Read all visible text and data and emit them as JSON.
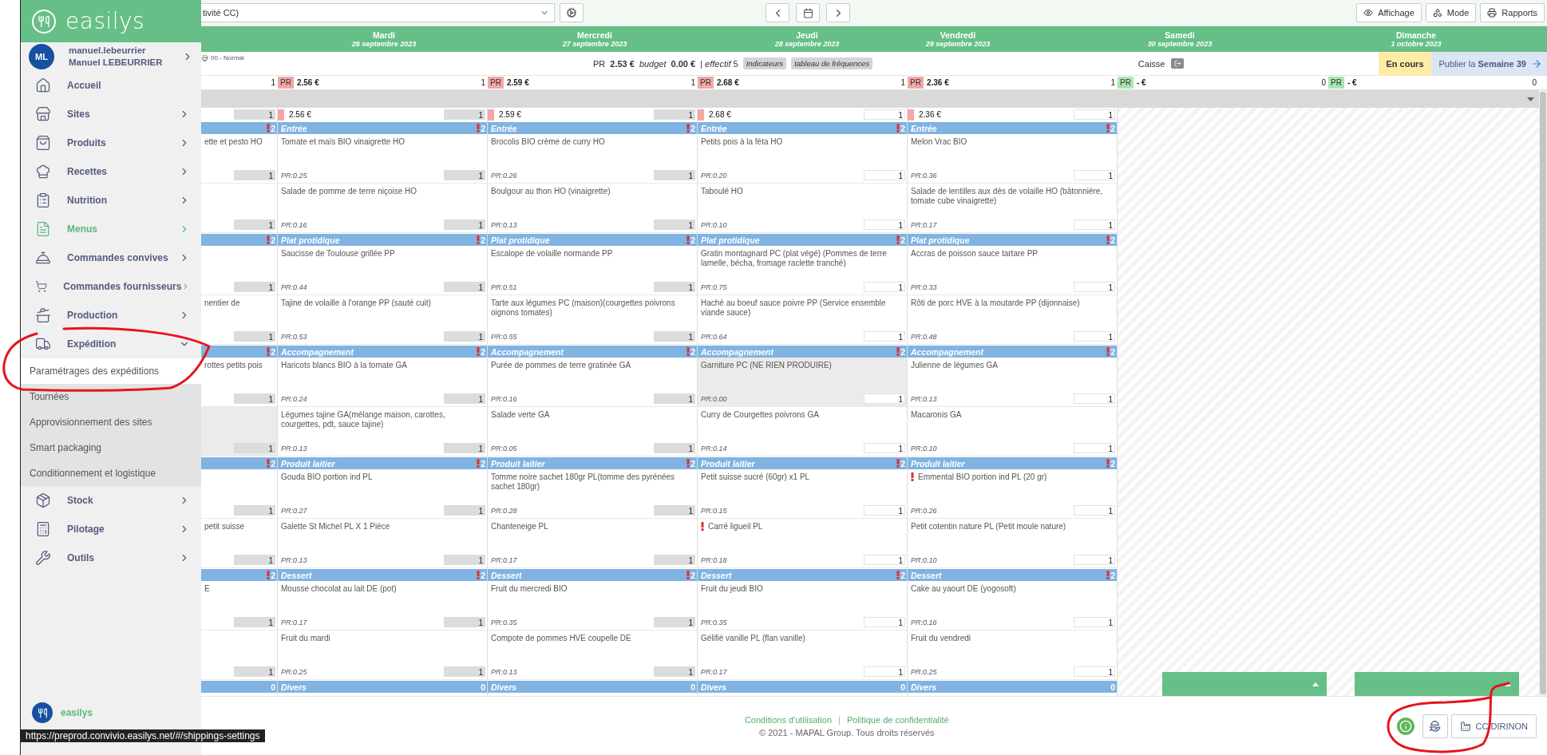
{
  "sidebar": {
    "brand": "easilys",
    "user": {
      "initials": "ML",
      "login": "manuel.lebeurrier",
      "name": "Manuel LEBEURRIER"
    },
    "items": [
      {
        "label": "Accueil",
        "active": false
      },
      {
        "label": "Sites",
        "active": false,
        "expanded": false
      },
      {
        "label": "Produits",
        "active": false,
        "expanded": false
      },
      {
        "label": "Recettes",
        "active": false,
        "expanded": false
      },
      {
        "label": "Nutrition",
        "active": false,
        "expanded": false
      },
      {
        "label": "Menus",
        "active": true,
        "expanded": false
      },
      {
        "label": "Commandes convives",
        "active": false,
        "expanded": false
      },
      {
        "label": "Commandes fournisseurs",
        "active": false,
        "expanded": false
      },
      {
        "label": "Production",
        "active": false,
        "expanded": false
      },
      {
        "label": "Expédition",
        "active": false,
        "expanded": true,
        "children": [
          {
            "label": "Paramétrages des expéditions",
            "selected": true
          },
          {
            "label": "Tournées",
            "selected": false
          },
          {
            "label": "Approvisionnement des sites",
            "selected": false
          },
          {
            "label": "Smart packaging",
            "selected": false
          },
          {
            "label": "Conditionnement et logistique",
            "selected": false
          }
        ]
      },
      {
        "label": "Stock",
        "active": false,
        "expanded": false
      },
      {
        "label": "Pilotage",
        "active": false,
        "expanded": false
      },
      {
        "label": "Outils",
        "active": false,
        "expanded": false
      }
    ],
    "footer_brand": "easilys"
  },
  "status_url": "https://preprod.convivio.easilys.net/#/shippings-settings",
  "toolbar": {
    "site_select": "tivité CC)",
    "buttons": [
      "Affichage",
      "Mode",
      "Rapports"
    ]
  },
  "day_headers": [
    {
      "day": "Mardi",
      "date": "26 septembre 2023"
    },
    {
      "day": "Mercredi",
      "date": "27 septembre 2023"
    },
    {
      "day": "Jeudi",
      "date": "28 septembre 2023"
    },
    {
      "day": "Vendredi",
      "date": "29 septembre 2023"
    },
    {
      "day": "Samedi",
      "date": "30 septembre 2023"
    },
    {
      "day": "Dimanche",
      "date": "1 octobre 2023"
    }
  ],
  "summary": {
    "mode": "00 - Normal",
    "pr_label": "PR",
    "pr_value": "2.53 €",
    "budget_label": "budget",
    "budget_value": "0.00 €",
    "effectif": "| *effectif* 5",
    "tags": [
      "Indicateurs",
      "tableau de fréquences"
    ],
    "caisse": "Caisse",
    "status": "En cours",
    "publish": "Publier la **Semaine 39**"
  },
  "totals": [
    {
      "count": "1"
    },
    {
      "label": "PR",
      "value": "2.56 €",
      "count": "1",
      "color": "#f4a7a7"
    },
    {
      "label": "PR",
      "value": "2.59 €",
      "count": "1",
      "color": "#f4a7a7"
    },
    {
      "label": "PR",
      "value": "2.68 €",
      "count": "1",
      "color": "#f4a7a7"
    },
    {
      "label": "PR",
      "value": "2.36 €",
      "count": "1",
      "color": "#f4a7a7"
    },
    {
      "label": "PR",
      "value": "- €",
      "count": "0",
      "color": "#a9e6b0"
    },
    {
      "label": "PR",
      "value": "- €",
      "count": "0",
      "color": "#a9e6b0"
    }
  ],
  "columns": [
    {
      "editable": false,
      "price": {
        "count": "1"
      },
      "sections": [
        {
          "badge": "2",
          "alert": true,
          "dishes": [
            {
              "name": "ette et pesto HO",
              "count": "1",
              "alert": false,
              "disabled": false
            },
            {
              "count": "1",
              "alert": false,
              "disabled": false
            }
          ]
        },
        {
          "badge": "2",
          "alert": true,
          "dishes": [
            {
              "count": "1",
              "alert": false,
              "disabled": false
            },
            {
              "name": "nentier de",
              "count": "1",
              "alert": false,
              "disabled": false
            }
          ]
        },
        {
          "badge": "2",
          "alert": true,
          "dishes": [
            {
              "name": "rottes petits pois",
              "count": "1",
              "alert": false,
              "disabled": false
            },
            {
              "count": "1",
              "alert": false,
              "disabled": true
            }
          ]
        },
        {
          "badge": "2",
          "alert": true,
          "dishes": [
            {
              "count": "1",
              "alert": false,
              "disabled": false
            },
            {
              "name": "petit suisse",
              "count": "1",
              "alert": false,
              "disabled": false
            }
          ]
        },
        {
          "badge": "2",
          "alert": true,
          "dishes": [
            {
              "name": "E",
              "count": "1",
              "alert": false,
              "disabled": false
            },
            {
              "count": "1",
              "alert": false,
              "disabled": false
            }
          ]
        },
        {
          "badge": "0",
          "alert": false
        }
      ]
    },
    {
      "editable": false,
      "price": {
        "value": "2.56 €",
        "count": "1"
      },
      "sections": [
        {
          "category": "Entrée",
          "badge": "2",
          "alert": true,
          "dishes": [
            {
              "name": "Tomate et maïs BIO vinaigrette HO",
              "pr": "PR:0.25",
              "count": "1",
              "alert": false,
              "disabled": false
            },
            {
              "name": "Salade de pomme de terre niçoise HO",
              "pr": "PR:0.16",
              "count": "1",
              "alert": false,
              "disabled": false
            }
          ]
        },
        {
          "category": "Plat protidique",
          "badge": "2",
          "alert": true,
          "dishes": [
            {
              "name": "Saucisse de Toulouse grillée PP",
              "pr": "PR:0.44",
              "count": "1",
              "alert": false,
              "disabled": false
            },
            {
              "name": "Tajine de volaille à l'orange PP (sauté cuit)",
              "pr": "PR:0.53",
              "count": "1",
              "alert": false,
              "disabled": false
            }
          ]
        },
        {
          "category": "Accompagnement",
          "badge": "2",
          "alert": true,
          "dishes": [
            {
              "name": "Haricots blancs BIO à la tomate GA",
              "pr": "PR:0.24",
              "count": "1",
              "alert": false,
              "disabled": false
            },
            {
              "name": "Légumes tajine GA(mélange maison, carottes, courgettes, pdt, sauce tajine)",
              "pr": "PR:0.13",
              "count": "1",
              "alert": false,
              "disabled": false
            }
          ]
        },
        {
          "category": "Produit laitier",
          "badge": "2",
          "alert": true,
          "dishes": [
            {
              "name": "Gouda BIO portion ind PL",
              "pr": "PR:0.27",
              "count": "1",
              "alert": false,
              "disabled": false
            },
            {
              "name": "Galette St Michel PL X 1 Pièce",
              "pr": "PR:0.13",
              "count": "1",
              "alert": false,
              "disabled": false
            }
          ]
        },
        {
          "category": "Dessert",
          "badge": "2",
          "alert": true,
          "dishes": [
            {
              "name": "Mousse chocolat au lait DE (pot)",
              "pr": "PR:0.17",
              "count": "1",
              "alert": false,
              "disabled": false
            },
            {
              "name": "Fruit du mardi",
              "pr": "PR:0.25",
              "count": "1",
              "alert": false,
              "disabled": false
            }
          ]
        },
        {
          "category": "Divers",
          "badge": "0",
          "alert": false
        }
      ]
    },
    {
      "editable": false,
      "price": {
        "value": "2.59 €",
        "count": "1"
      },
      "sections": [
        {
          "category": "Entrée",
          "badge": "2",
          "alert": true,
          "dishes": [
            {
              "name": "Brocolis BIO crème de curry HO",
              "pr": "PR:0.26",
              "count": "1",
              "alert": false,
              "disabled": false
            },
            {
              "name": "Boulgour au thon HO (vinaigrette)",
              "pr": "PR:0.13",
              "count": "1",
              "alert": false,
              "disabled": false
            }
          ]
        },
        {
          "category": "Plat protidique",
          "badge": "2",
          "alert": true,
          "dishes": [
            {
              "name": "Escalope de volaille normande PP",
              "pr": "PR:0.51",
              "count": "1",
              "alert": false,
              "disabled": false
            },
            {
              "name": "Tarte aux légumes PC (maison)(courgettes poivrons oignons tomates)",
              "pr": "PR:0.55",
              "count": "1",
              "alert": false,
              "disabled": false
            }
          ]
        },
        {
          "category": "Accompagnement",
          "badge": "2",
          "alert": true,
          "dishes": [
            {
              "name": "Purée de pommes de terre gratinée GA",
              "pr": "PR:0.16",
              "count": "1",
              "alert": false,
              "disabled": false
            },
            {
              "name": "Salade verte GA",
              "pr": "PR:0.05",
              "count": "1",
              "alert": false,
              "disabled": false
            }
          ]
        },
        {
          "category": "Produit laitier",
          "badge": "2",
          "alert": true,
          "dishes": [
            {
              "name": "Tomme noire sachet 180gr PL(tomme des pyrénées sachet 180gr)",
              "pr": "PR:0.28",
              "count": "1",
              "alert": false,
              "disabled": false
            },
            {
              "name": "Chanteneige PL",
              "pr": "PR:0.17",
              "count": "1",
              "alert": false,
              "disabled": false
            }
          ]
        },
        {
          "category": "Dessert",
          "badge": "2",
          "alert": true,
          "dishes": [
            {
              "name": "Fruit du mercredi BIO",
              "pr": "PR:0.35",
              "count": "1",
              "alert": false,
              "disabled": false
            },
            {
              "name": "Compote de pommes HVE coupelle DE",
              "pr": "PR:0.13",
              "count": "1",
              "alert": false,
              "disabled": false
            }
          ]
        },
        {
          "category": "Divers",
          "badge": "0",
          "alert": false
        }
      ]
    },
    {
      "editable": true,
      "price": {
        "value": "2.68 €",
        "count": "1"
      },
      "sections": [
        {
          "category": "Entrée",
          "badge": "2",
          "alert": true,
          "dishes": [
            {
              "name": "Petits pois à la féta HO",
              "pr": "PR:0.20",
              "count": "1",
              "alert": false,
              "disabled": false
            },
            {
              "name": "Taboulé HO",
              "pr": "PR:0.10",
              "count": "1",
              "alert": false,
              "disabled": false
            }
          ]
        },
        {
          "category": "Plat protidique",
          "badge": "2",
          "alert": true,
          "dishes": [
            {
              "name": "Gratin montagnard PC (plat végé) (Pommes de terre lamelle, bécha, fromage raclette tranché)",
              "pr": "PR:0.75",
              "count": "1",
              "alert": false,
              "disabled": false
            },
            {
              "name": "Haché au boeuf sauce poivre PP (Service ensemble viande sauce)",
              "pr": "PR:0.64",
              "count": "1",
              "alert": false,
              "disabled": false
            }
          ]
        },
        {
          "category": "Accompagnement",
          "badge": "2",
          "alert": true,
          "dishes": [
            {
              "name": "Garniture PC (NE RIEN PRODUIRE)",
              "pr": "PR:0.00",
              "count": "1",
              "alert": false,
              "disabled": true
            },
            {
              "name": "Curry de Courgettes poivrons GA",
              "pr": "PR:0.14",
              "count": "1",
              "alert": false,
              "disabled": false
            }
          ]
        },
        {
          "category": "Produit laitier",
          "badge": "2",
          "alert": true,
          "dishes": [
            {
              "name": "Petit suisse sucré (60gr) x1 PL",
              "pr": "PR:0.15",
              "count": "1",
              "alert": false,
              "disabled": false
            },
            {
              "name": "Carré ligueil PL",
              "pr": "PR:0.18",
              "count": "1",
              "alert": true,
              "disabled": false
            }
          ]
        },
        {
          "category": "Dessert",
          "badge": "2",
          "alert": true,
          "dishes": [
            {
              "name": "Fruit du jeudi BIO",
              "pr": "PR:0.35",
              "count": "1",
              "alert": false,
              "disabled": false
            },
            {
              "name": "Gélifié vanille PL (flan vanille)",
              "pr": "PR:0.17",
              "count": "1",
              "alert": false,
              "disabled": false
            }
          ]
        },
        {
          "category": "Divers",
          "badge": "0",
          "alert": false
        }
      ]
    },
    {
      "editable": true,
      "price": {
        "value": "2.36 €",
        "count": "1"
      },
      "sections": [
        {
          "category": "Entrée",
          "badge": "2",
          "alert": true,
          "dishes": [
            {
              "name": "Melon Vrac BIO",
              "pr": "PR:0.36",
              "count": "1",
              "alert": false,
              "disabled": false
            },
            {
              "name": "Salade de lentilles aux dès de volaille HO (bâtonnière, tomate cube vinaigrette)",
              "pr": "PR:0.17",
              "count": "1",
              "alert": false,
              "disabled": false
            }
          ]
        },
        {
          "category": "Plat protidique",
          "badge": "2",
          "alert": true,
          "dishes": [
            {
              "name": "Accras de poisson sauce tartare PP",
              "pr": "PR:0.33",
              "count": "1",
              "alert": false,
              "disabled": false
            },
            {
              "name": "Rôti de porc HVE à la moutarde PP (dijonnaise)",
              "pr": "PR:0.48",
              "count": "1",
              "alert": false,
              "disabled": false
            }
          ]
        },
        {
          "category": "Accompagnement",
          "badge": "2",
          "alert": true,
          "dishes": [
            {
              "name": "Julienne de légumes GA",
              "pr": "PR:0.13",
              "count": "1",
              "alert": false,
              "disabled": false
            },
            {
              "name": "Macaronis GA",
              "pr": "PR:0.10",
              "count": "1",
              "alert": false,
              "disabled": false
            }
          ]
        },
        {
          "category": "Produit laitier",
          "badge": "2",
          "alert": true,
          "dishes": [
            {
              "name": "Emmental BIO portion ind PL (20 gr)",
              "pr": "PR:0.26",
              "count": "1",
              "alert": true,
              "disabled": false
            },
            {
              "name": "Petit cotentin nature PL (Petit moule nature)",
              "pr": "PR:0.10",
              "count": "1",
              "alert": false,
              "disabled": false
            }
          ]
        },
        {
          "category": "Dessert",
          "badge": "2",
          "alert": true,
          "dishes": [
            {
              "name": "Cake au yaourt DE (yogosoft)",
              "pr": "PR:0.16",
              "count": "1",
              "alert": false,
              "disabled": false
            },
            {
              "name": "Fruit du vendredi",
              "pr": "PR:0.25",
              "count": "1",
              "alert": false,
              "disabled": false
            }
          ]
        },
        {
          "category": "Divers",
          "badge": "0",
          "alert": false
        }
      ]
    }
  ],
  "weekend_panels": [
    {
      "expanded": false
    },
    {
      "expanded": false
    }
  ],
  "footer": {
    "links": [
      "Conditions d'utilisation",
      "Politique de confidentialité"
    ],
    "separator": "|",
    "copyright": "© 2021 - MAPAL Group. Tous droits réservés",
    "site": "CC DIRINON"
  },
  "annotations": [
    {
      "kind": "sidebar-loop"
    },
    {
      "kind": "corner-loop"
    }
  ]
}
